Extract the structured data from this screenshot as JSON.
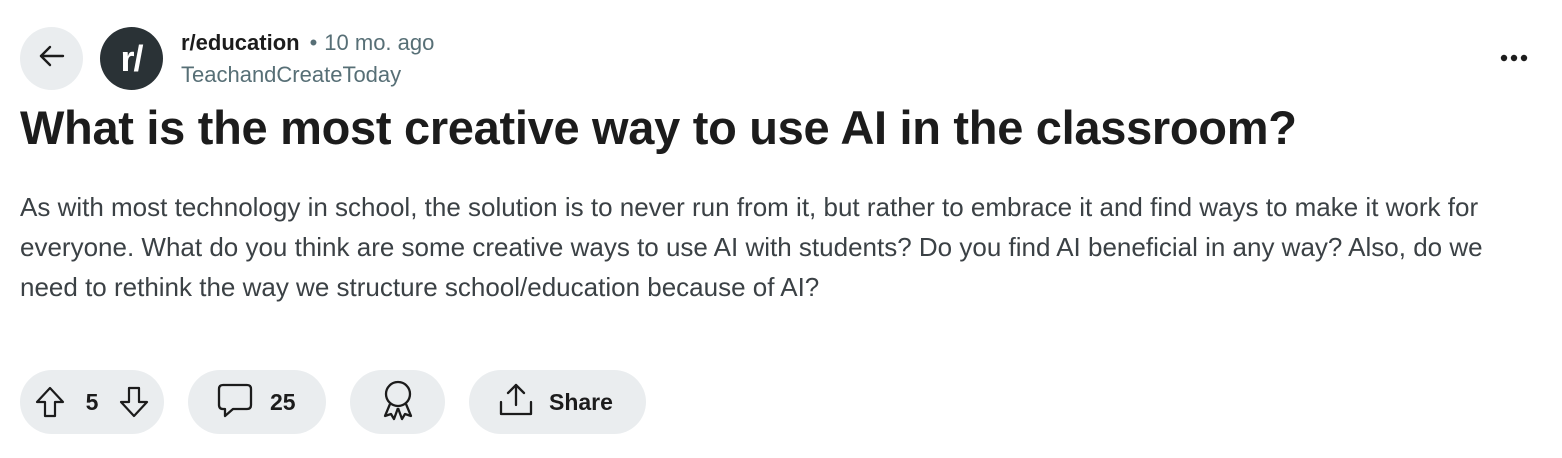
{
  "header": {
    "back_icon": "arrow-left-icon",
    "avatar_text": "r/",
    "subreddit": "r/education",
    "separator": "•",
    "age": "10 mo. ago",
    "author": "TeachandCreateToday",
    "more_icon": "ellipsis-icon"
  },
  "post": {
    "title": "What is the most creative way to use AI in the classroom?",
    "body": "As with most technology in school, the solution is to never run from it, but rather to embrace it and find ways to make it work for everyone. What do you think are some creative ways to use AI with students? Do you find AI beneficial in any way? Also, do we need to rethink the way we structure school/education because of AI?"
  },
  "actions": {
    "vote_count": "5",
    "comment_count": "25",
    "share_label": "Share",
    "upvote_icon": "upvote-arrow-icon",
    "downvote_icon": "downvote-arrow-icon",
    "comment_icon": "comment-bubble-icon",
    "award_icon": "award-ribbon-icon",
    "share_icon": "share-upload-icon"
  },
  "colors": {
    "text_primary": "#1c1c1c",
    "text_secondary": "#576f76",
    "pill_background": "#eaedef",
    "avatar_background": "#2a3236"
  }
}
